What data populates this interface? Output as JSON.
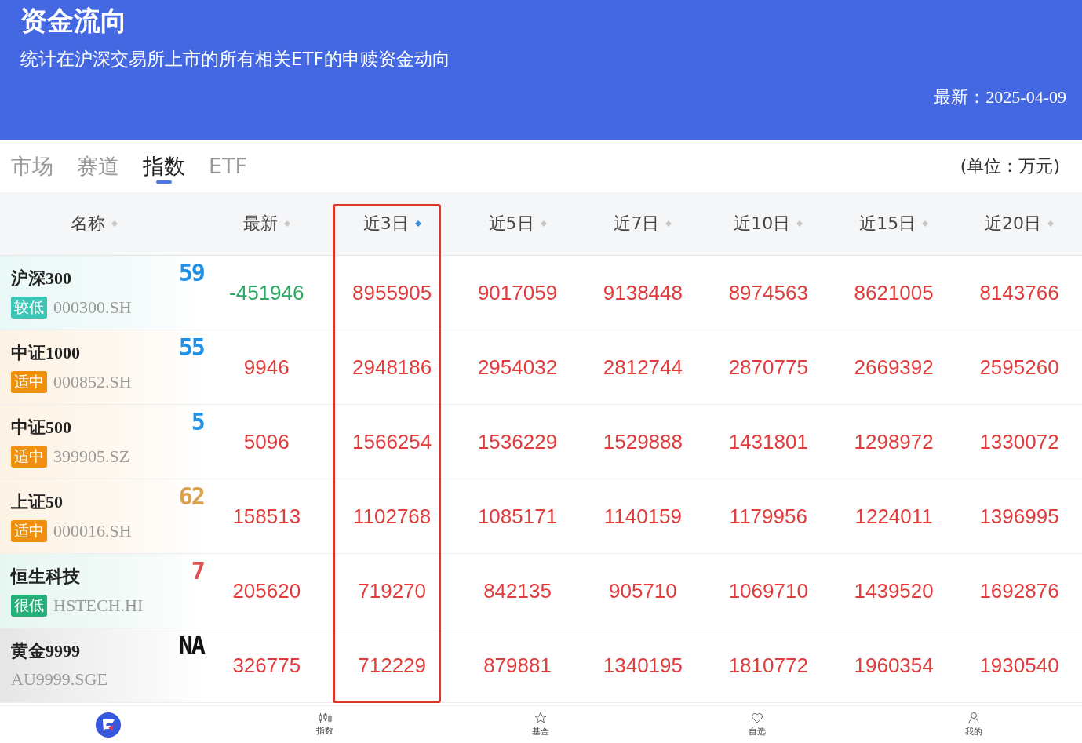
{
  "header": {
    "title": "资金流向",
    "subtitle": "统计在沪深交易所上市的所有相关ETF的申赎资金动向",
    "updated": "最新：2025-04-09"
  },
  "tabs": [
    {
      "label": "市场",
      "selected": false
    },
    {
      "label": "赛道",
      "selected": false
    },
    {
      "label": "指数",
      "selected": true
    },
    {
      "label": "ETF",
      "selected": false
    }
  ],
  "unit": "(单位：万元)",
  "table": {
    "columns": [
      {
        "label": "名称",
        "selected": false
      },
      {
        "label": "最新",
        "selected": false
      },
      {
        "label": "近3日",
        "selected": true
      },
      {
        "label": "近5日",
        "selected": false
      },
      {
        "label": "近7日",
        "selected": false
      },
      {
        "label": "近10日",
        "selected": false
      },
      {
        "label": "近15日",
        "selected": false
      },
      {
        "label": "近20日",
        "selected": false
      }
    ],
    "rows": [
      {
        "name": "沪深300",
        "code": "000300.SH",
        "tag": {
          "label": "较低",
          "color": "#3cc4b4"
        },
        "score": {
          "text": "59",
          "color": "#1e90e6"
        },
        "values": [
          {
            "v": "-451946",
            "up": false
          },
          {
            "v": "8955905",
            "up": true
          },
          {
            "v": "9017059",
            "up": true
          },
          {
            "v": "9138448",
            "up": true
          },
          {
            "v": "8974563",
            "up": true
          },
          {
            "v": "8621005",
            "up": true
          },
          {
            "v": "8143766",
            "up": true
          }
        ]
      },
      {
        "name": "中证1000",
        "code": "000852.SH",
        "tag": {
          "label": "适中",
          "color": "#f0900e"
        },
        "score": {
          "text": "55",
          "color": "#1e90e6"
        },
        "values": [
          {
            "v": "9946",
            "up": true
          },
          {
            "v": "2948186",
            "up": true
          },
          {
            "v": "2954032",
            "up": true
          },
          {
            "v": "2812744",
            "up": true
          },
          {
            "v": "2870775",
            "up": true
          },
          {
            "v": "2669392",
            "up": true
          },
          {
            "v": "2595260",
            "up": true
          }
        ]
      },
      {
        "name": "中证500",
        "code": "399905.SZ",
        "tag": {
          "label": "适中",
          "color": "#f0900e"
        },
        "score": {
          "text": "5",
          "color": "#1e90e6"
        },
        "values": [
          {
            "v": "5096",
            "up": true
          },
          {
            "v": "1566254",
            "up": true
          },
          {
            "v": "1536229",
            "up": true
          },
          {
            "v": "1529888",
            "up": true
          },
          {
            "v": "1431801",
            "up": true
          },
          {
            "v": "1298972",
            "up": true
          },
          {
            "v": "1330072",
            "up": true
          }
        ]
      },
      {
        "name": "上证50",
        "code": "000016.SH",
        "tag": {
          "label": "适中",
          "color": "#f0900e"
        },
        "score": {
          "text": "62",
          "color": "#d9a050"
        },
        "values": [
          {
            "v": "158513",
            "up": true
          },
          {
            "v": "1102768",
            "up": true
          },
          {
            "v": "1085171",
            "up": true
          },
          {
            "v": "1140159",
            "up": true
          },
          {
            "v": "1179956",
            "up": true
          },
          {
            "v": "1224011",
            "up": true
          },
          {
            "v": "1396995",
            "up": true
          }
        ]
      },
      {
        "name": "恒生科技",
        "code": "HSTECH.HI",
        "tag": {
          "label": "很低",
          "color": "#25b07a"
        },
        "score": {
          "text": "7",
          "color": "#e05050"
        },
        "values": [
          {
            "v": "205620",
            "up": true
          },
          {
            "v": "719270",
            "up": true
          },
          {
            "v": "842135",
            "up": true
          },
          {
            "v": "905710",
            "up": true
          },
          {
            "v": "1069710",
            "up": true
          },
          {
            "v": "1439520",
            "up": true
          },
          {
            "v": "1692876",
            "up": true
          }
        ]
      },
      {
        "name": "黄金9999",
        "code": "AU9999.SGE",
        "score": {
          "text": "NA",
          "color": "#111111"
        },
        "values": [
          {
            "v": "326775",
            "up": true
          },
          {
            "v": "712229",
            "up": true
          },
          {
            "v": "879881",
            "up": true
          },
          {
            "v": "1340195",
            "up": true
          },
          {
            "v": "1810772",
            "up": true
          },
          {
            "v": "1960354",
            "up": true
          },
          {
            "v": "1930540",
            "up": true
          }
        ]
      }
    ]
  },
  "nav": [
    {
      "kind": "logo"
    },
    {
      "kind": "chart",
      "label": "指数"
    },
    {
      "kind": "star",
      "label": "基金"
    },
    {
      "kind": "heart",
      "label": "自选"
    },
    {
      "kind": "person",
      "label": "我的"
    }
  ]
}
